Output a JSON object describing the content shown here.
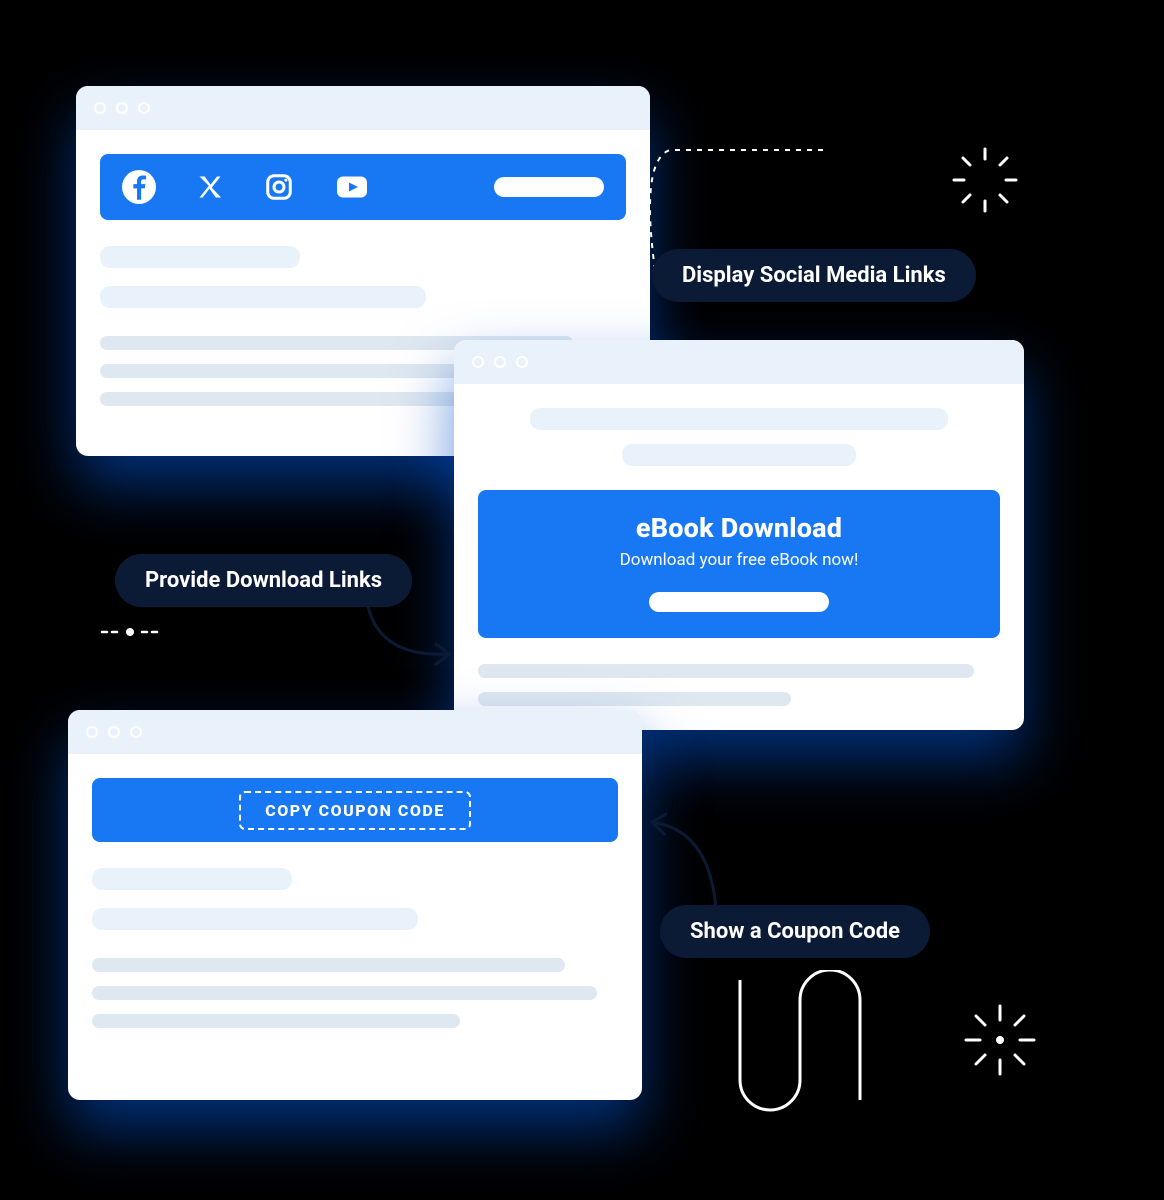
{
  "labels": {
    "social": "Display Social Media Links",
    "download": "Provide Download Links",
    "coupon": "Show a Coupon Code"
  },
  "cards": {
    "social": {
      "icons": [
        "facebook",
        "x-twitter",
        "instagram",
        "youtube"
      ]
    },
    "ebook": {
      "title": "eBook Download",
      "subtitle": "Download your free eBook now!"
    },
    "coupon": {
      "button": "COPY COUPON CODE"
    }
  },
  "colors": {
    "accent": "#1877f2",
    "dark": "#0b1b36",
    "soft_blue": "#e9f2fb"
  }
}
